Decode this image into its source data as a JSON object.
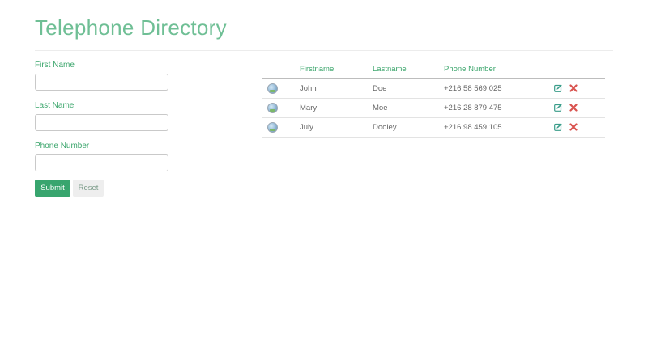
{
  "header": {
    "title": "Telephone Directory"
  },
  "form": {
    "first_name_label": "First Name",
    "first_name_value": "",
    "last_name_label": "Last Name",
    "last_name_value": "",
    "phone_label": "Phone Number",
    "phone_value": "",
    "submit_label": "Submit",
    "reset_label": "Reset"
  },
  "table": {
    "headers": [
      "",
      "Firstname",
      "Lastname",
      "Phone Number",
      ""
    ],
    "rows": [
      {
        "firstname": "John",
        "lastname": "Doe",
        "phone": "+216 58 569 025"
      },
      {
        "firstname": "Mary",
        "lastname": "Moe",
        "phone": "+216 28 879 475"
      },
      {
        "firstname": "July",
        "lastname": "Dooley",
        "phone": "+216 98 459 105"
      }
    ]
  },
  "colors": {
    "accent": "#38a56e",
    "title": "#6fbf95",
    "edit_icon": "#3a9d8a",
    "delete_icon": "#d9534f"
  },
  "icons": {
    "avatar": "avatar-image",
    "edit": "edit-icon",
    "delete": "delete-icon"
  }
}
